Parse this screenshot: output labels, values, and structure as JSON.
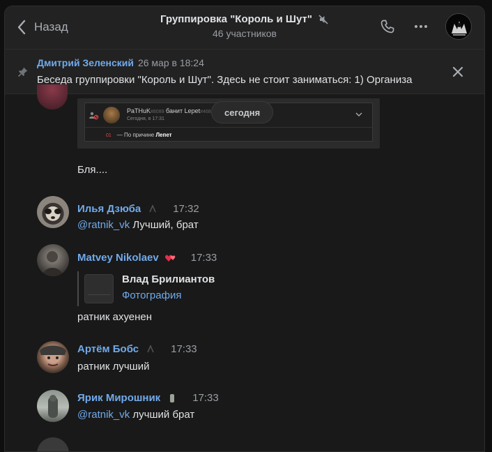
{
  "header": {
    "back_label": "Назад",
    "title": "Группировка \"Король и Шут\"",
    "subtitle": "46 участников",
    "icons": [
      "back-chevron-icon",
      "muted-icon",
      "phone-icon",
      "more-icon"
    ]
  },
  "pinned": {
    "author": "Дмитрий Зеленский",
    "date": "26 мар в 18:24",
    "text": "Беседа группировки \"Король и Шут\". Здесь не стоит заниматься: 1) Организа"
  },
  "date_pill": "сегодня",
  "screenshot_attachment": {
    "user": "PaTHuK",
    "user_suffix": "#8089",
    "action": "банит Lepet",
    "action_suffix": "#468",
    "time": "Сегодня, в 17:31",
    "reason_code": "01",
    "reason_prefix": "— По причине",
    "reason_value": "Лепет"
  },
  "messages": [
    {
      "text": "Бля...."
    },
    {
      "author": "Илья Дзюба",
      "time": "17:32",
      "mention": "@ratnik_vk",
      "text": " Лучший, брат"
    },
    {
      "author": "Matvey Nikolaev",
      "time": "17:33",
      "forward_name": "Влад Брилиантов",
      "forward_type": "Фотография",
      "text": "ратник ахуенен"
    },
    {
      "author": "Артём Бобс",
      "time": "17:33",
      "text": "ратник лучший"
    },
    {
      "author": "Ярик Мирошник",
      "time": "17:33",
      "mention": "@ratnik_vk",
      "text": " лучший брат"
    }
  ],
  "colors": {
    "accent": "#71aaeb",
    "background": "#191919",
    "text": "#e1e3e6",
    "muted": "#9a9ea3"
  }
}
